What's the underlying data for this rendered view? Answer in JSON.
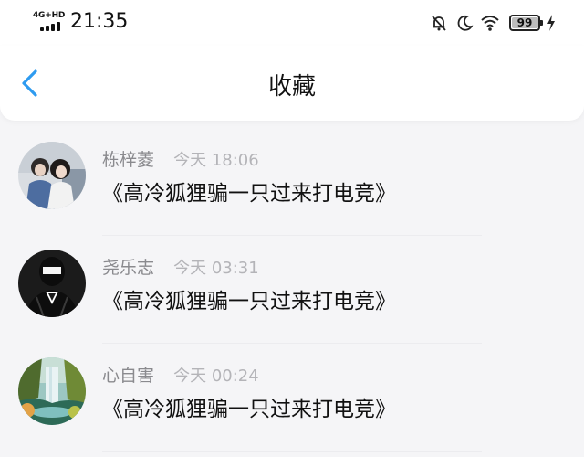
{
  "status_bar": {
    "network_label": "4G+HD",
    "time": "21:35",
    "battery_level": "99"
  },
  "header": {
    "title": "收藏",
    "back_icon": "chevron-left-icon",
    "accent_color": "#2e9bf0"
  },
  "favorites": [
    {
      "name": "栋梓菱",
      "time": "今天 18:06",
      "message": "《高冷狐狸骗一只过来打电竞》",
      "avatar_icon": "two-girls-photo-avatar"
    },
    {
      "name": "尧乐志",
      "time": "今天 03:31",
      "message": "《高冷狐狸骗一只过来打电竞》",
      "avatar_icon": "suited-figure-avatar"
    },
    {
      "name": "心自害",
      "time": "今天 00:24",
      "message": "《高冷狐狸骗一只过来打电竞》",
      "avatar_icon": "waterfall-landscape-avatar"
    }
  ]
}
